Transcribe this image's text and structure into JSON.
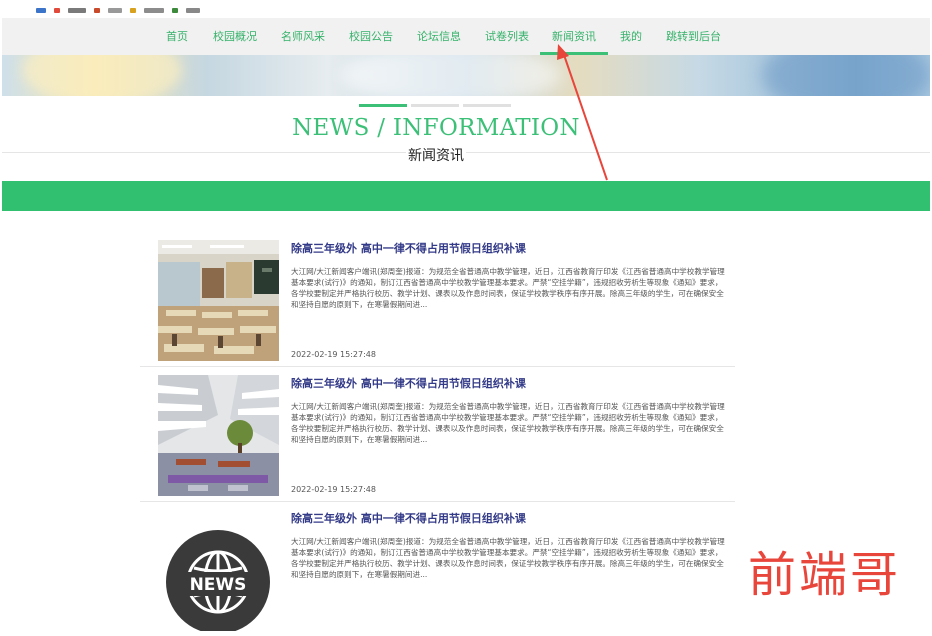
{
  "nav": {
    "items": [
      "首页",
      "校园概况",
      "名师风采",
      "校园公告",
      "论坛信息",
      "试卷列表",
      "新闻资讯",
      "我的",
      "跳转到后台"
    ],
    "active": "新闻资讯"
  },
  "section": {
    "title_en": "NEWS / INFORMATION",
    "title_cn": "新闻资讯"
  },
  "news": [
    {
      "title": "除高三年级外 高中一律不得占用节假日组织补课",
      "summary": "大江网/大江新闻客户端讯(郑周奎)报道：为规范全省普通高中教学管理，近日，江西省教育厅印发《江西省普通高中学校教学管理基本要求(试行)》的通知，制订江西省普通高中学校教学管理基本要求。严禁“空挂学籍”，违规招收劳析生等现象《通知》要求，各学校要制定并严格执行校历、教学计划、课表以及作息时间表，保证学校教学秩序有序开展。除高三年级的学生，可在确保安全和坚持自愿的原则下，在寒暑假期间进...",
      "date": "2022-02-19 15:27:48",
      "image": "classroom"
    },
    {
      "title": "除高三年级外 高中一律不得占用节假日组织补课",
      "summary": "大江网/大江新闻客户端讯(郑周奎)报道：为规范全省普通高中教学管理，近日，江西省教育厅印发《江西省普通高中学校教学管理基本要求(试行)》的通知，制订江西省普通高中学校教学管理基本要求。严禁“空挂学籍”，违规招收劳析生等现象《通知》要求，各学校要制定并严格执行校历、教学计划、课表以及作息时间表，保证学校教学秩序有序开展。除高三年级的学生，可在确保安全和坚持自愿的原则下，在寒暑假期间进...",
      "date": "2022-02-19 15:27:48",
      "image": "school-courtyard"
    },
    {
      "title": "除高三年级外 高中一律不得占用节假日组织补课",
      "summary": "大江网/大江新闻客户端讯(郑周奎)报道：为规范全省普通高中教学管理，近日，江西省教育厅印发《江西省普通高中学校教学管理基本要求(试行)》的通知，制订江西省普通高中学校教学管理基本要求。严禁“空挂学籍”，违规招收劳析生等现象《通知》要求，各学校要制定并严格执行校历、教学计划、课表以及作息时间表，保证学校教学秩序有序开展。除高三年级的学生，可在确保安全和坚持自愿的原则下，在寒暑假期间进...",
      "date": "",
      "image": "news-globe-icon",
      "icon_text": "NEWS"
    }
  ],
  "watermark": "前端哥",
  "colors": {
    "accent": "#3cc078",
    "green_bar": "#30c070",
    "title_blue": "#333a88",
    "arrow_red": "#e8453b"
  }
}
